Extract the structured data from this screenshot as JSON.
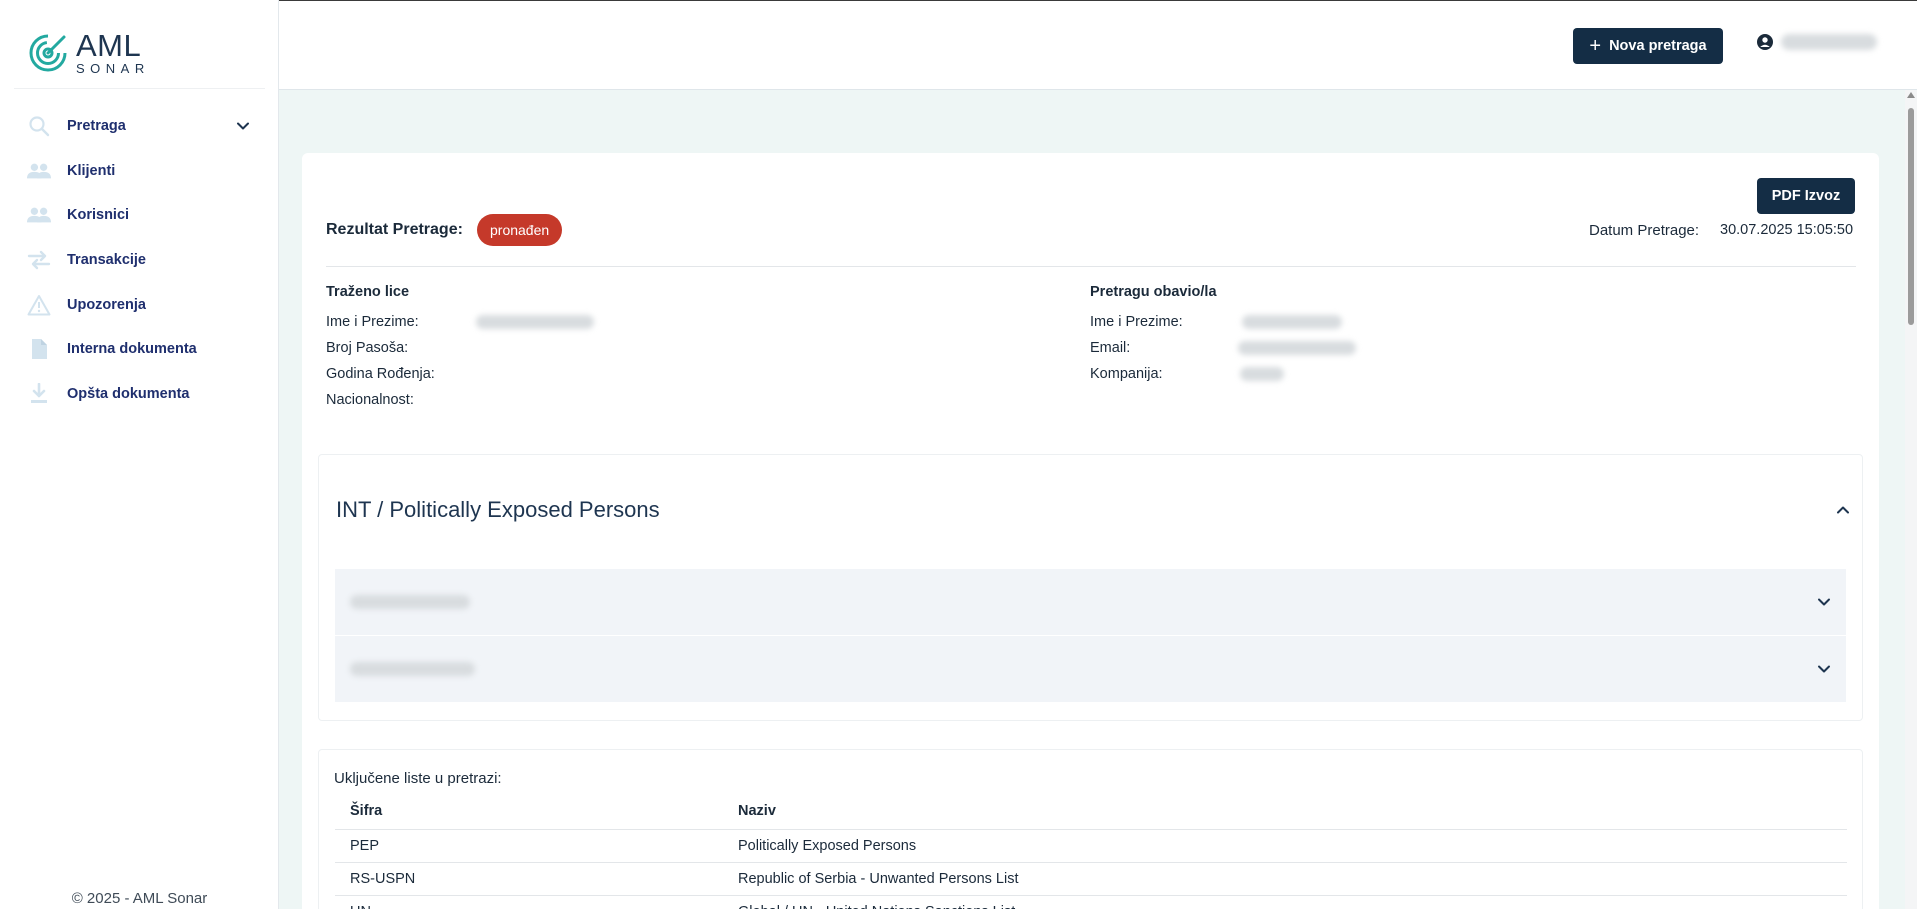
{
  "brand": {
    "name": "AML",
    "sub": "SONAR",
    "accent": "#23a9a0"
  },
  "sidebar": {
    "items": [
      {
        "label": "Pretraga",
        "icon": "search-icon"
      },
      {
        "label": "Klijenti",
        "icon": "users-icon"
      },
      {
        "label": "Korisnici",
        "icon": "users-icon"
      },
      {
        "label": "Transakcije",
        "icon": "swap-arrows-icon"
      },
      {
        "label": "Upozorenja",
        "icon": "warning-icon"
      },
      {
        "label": "Interna dokumenta",
        "icon": "document-icon"
      },
      {
        "label": "Opšta dokumenta",
        "icon": "download-icon"
      }
    ],
    "copyright": "© 2025 - AML Sonar"
  },
  "header": {
    "new_search_label": "Nova pretraga"
  },
  "result": {
    "pdf_label": "PDF Izvoz",
    "label": "Rezultat Pretrage:",
    "status": "pronađen",
    "date_label": "Datum Pretrage:",
    "date_value": "30.07.2025 15:05:50"
  },
  "searched_person": {
    "title": "Traženo lice",
    "fields": [
      "Ime i Prezime:",
      "Broj Pasoša:",
      "Godina Rođenja:",
      "Nacionalnost:"
    ]
  },
  "performed_by": {
    "title": "Pretragu obavio/la",
    "fields": [
      "Ime i Prezime:",
      "Email:",
      "Kompanija:"
    ]
  },
  "accordion": {
    "title": "INT / Politically Exposed Persons"
  },
  "lists": {
    "title": "Uključene liste u pretrazi:",
    "columns": [
      "Šifra",
      "Naziv"
    ],
    "rows": [
      [
        "PEP",
        "Politically Exposed Persons"
      ],
      [
        "RS-USPN",
        "Republic of Serbia - Unwanted Persons List"
      ],
      [
        "UN",
        "Global / UN - United Nations Sanctions List"
      ]
    ]
  }
}
